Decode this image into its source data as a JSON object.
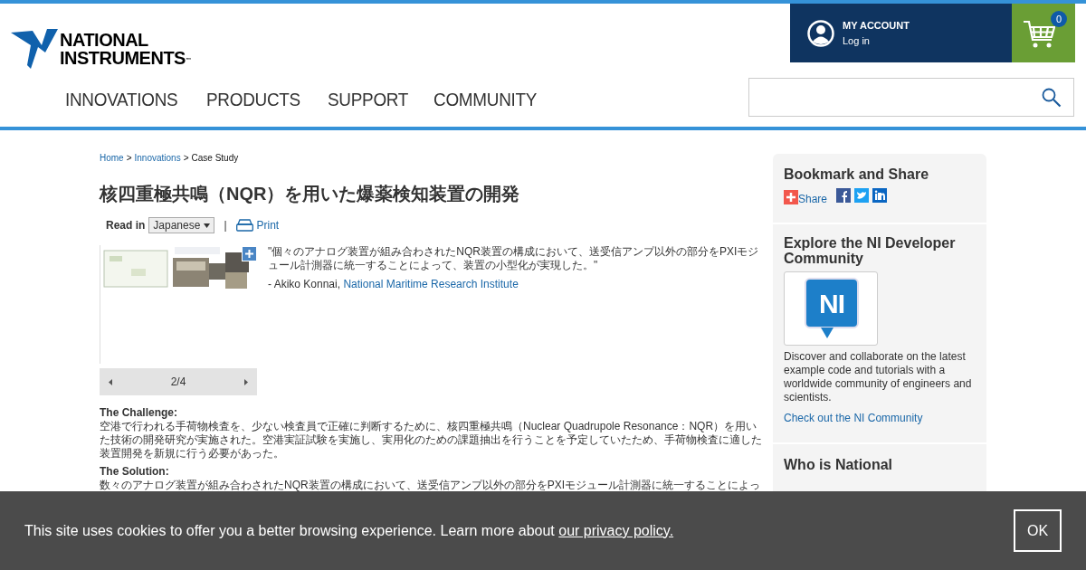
{
  "logo": {
    "line_1": "NATIONAL",
    "line_2": "INSTRUMENTS",
    "mark": "™"
  },
  "account": {
    "title": "MY ACCOUNT",
    "link": "Log in"
  },
  "cart": {
    "count": "0"
  },
  "nav": [
    {
      "label": "INNOVATIONS"
    },
    {
      "label": "PRODUCTS"
    },
    {
      "label": "SUPPORT"
    },
    {
      "label": "COMMUNITY"
    }
  ],
  "breadcrumb": [
    {
      "label": "Home",
      "link": true
    },
    {
      "label": ">",
      "link": false
    },
    {
      "label": "Innovations",
      "link": true
    },
    {
      "label": ">",
      "link": false
    },
    {
      "label": "Case Study",
      "link": false
    }
  ],
  "title": "核四重極共鳴（NQR）を用いた爆薬検知装置の開発",
  "read_in": {
    "label": "Read in",
    "language": "Japanese",
    "separator": "|",
    "print": "Print"
  },
  "gallery": {
    "page": "2/4"
  },
  "quote": {
    "text": "\"個々のアナログ装置が組み合わされたNQR装置の構成において、送受信アンプ以外の部分をPXIモジュール計測器に統一することによって、装置の小型化が実現した。\"",
    "author": "- Akiko Konnai,",
    "affiliation": "National Maritime Research Institute"
  },
  "sections": [
    {
      "heading": "The Challenge:",
      "text": "空港で行われる手荷物検査を、少ない検査員で正確に判断するために、核四重極共鳴（Nuclear Quadrupole Resonance：NQR）を用いた技術の開発研究が実施された。空港実証試験を実施し、実用化のための課題抽出を行うことを予定していたため、手荷物検査に適した装置開発を新規に行う必要があった。"
    },
    {
      "heading": "The Solution:",
      "text": "数々のアナログ装置が組み合わされたNQR装置の構成において、送受信アンプ以外の部分をPXIモジュール計測器に統一することによっ"
    }
  ],
  "sidebar": {
    "share": {
      "title": "Bookmark and Share",
      "share_label": "Share"
    },
    "community": {
      "title": "Explore the NI Developer Community",
      "logo_text": "NI",
      "text": "Discover and collaborate on the latest example code and tutorials with a worldwide community of engineers and scientists.",
      "link": "Check out the NI Community"
    },
    "about": {
      "title": "Who is National"
    }
  },
  "cookie": {
    "text": "This site uses cookies to offer you a better browsing experience. Learn more about",
    "link": "our privacy policy.",
    "button": "OK"
  }
}
